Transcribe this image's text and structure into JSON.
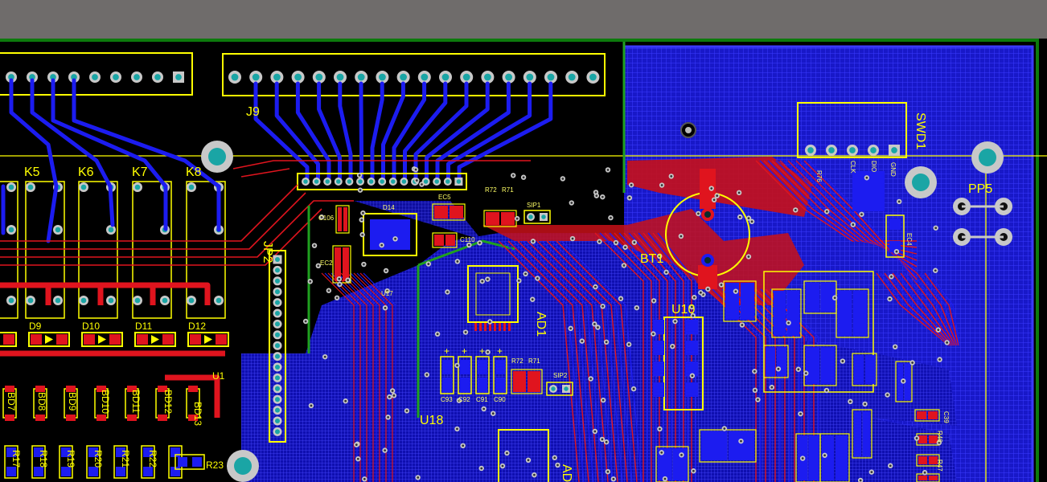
{
  "app": {
    "view": "PCB layout editor canvas"
  },
  "colors": {
    "background": "#6f6c6b",
    "board": "#000000",
    "board_outline": "#0d7a0d",
    "top_copper": "#e0141e",
    "bottom_copper": "#1c1cf0",
    "pour_grid": "#0a0adc",
    "silkscreen": "#ffff00",
    "pad": "#c8c8c8",
    "drill": "#1aa5a5"
  },
  "components": {
    "j9": "J9",
    "jp2": "JP2",
    "k5": "K5",
    "k6": "K6",
    "k7": "K7",
    "k8": "K8",
    "d9": "D9",
    "d10": "D10",
    "d11": "D11",
    "d12": "D12",
    "bt1": "BT1",
    "u10": "U10",
    "u18": "U18",
    "u17": "U17",
    "u1": "U1",
    "pp5": "PP5",
    "swd1": "SWD1",
    "ad1": "AD1",
    "ad_partial": "AD",
    "d14": "D14",
    "ec5": "EC5",
    "ec2": "EC2",
    "ec4": "EC4",
    "c106": "C106",
    "c110": "C110",
    "r72_top": "R72",
    "r71_top": "R71",
    "sip1": "SIP1",
    "sip2": "SIP2",
    "r72_mid": "R72",
    "r71_mid": "R71",
    "c93": "C93",
    "c92": "C92",
    "c91": "C91",
    "c90": "C90",
    "bd7": "BD7",
    "bd8": "BD8",
    "bd9": "BD9",
    "bd10": "BD10",
    "bd11": "BD11",
    "bd12": "BD12",
    "bd13": "BD13",
    "r17": "R17",
    "r18": "R18",
    "r19": "R19",
    "r20": "R20",
    "r21": "R21",
    "r22": "R22",
    "r23": "R23",
    "r46": "R46",
    "r47": "R47",
    "c39": "C39",
    "gnd": "GND",
    "clk": "CLK",
    "dio": "DIO",
    "r76": "R76"
  }
}
